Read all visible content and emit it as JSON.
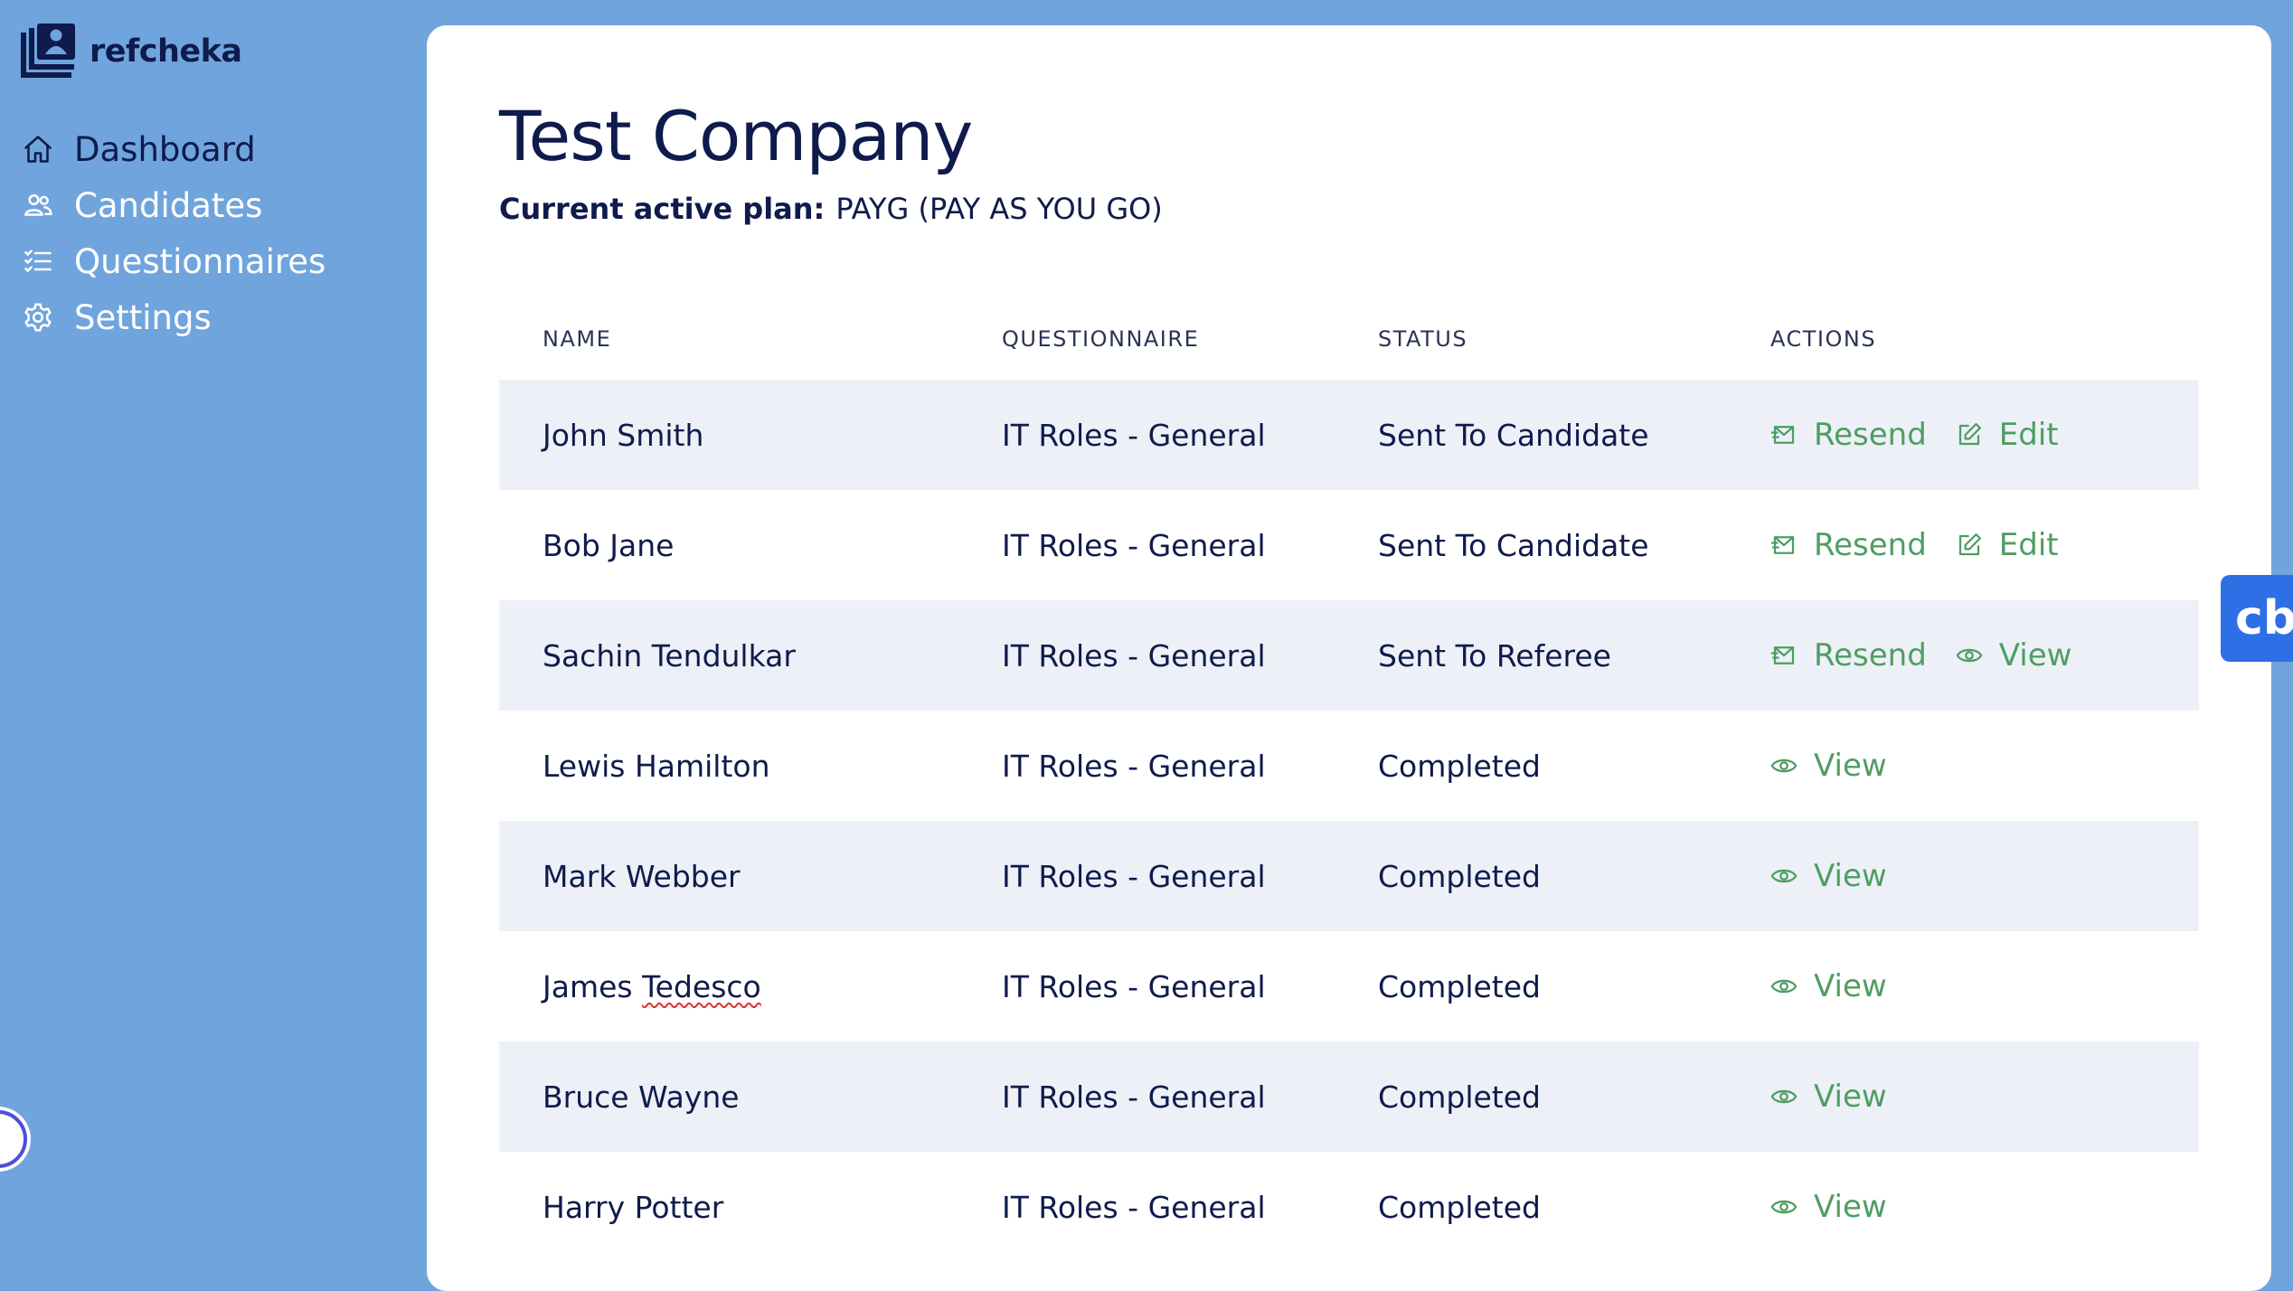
{
  "app": {
    "name": "refcheka"
  },
  "sidebar": {
    "items": [
      {
        "label": "Dashboard",
        "icon": "home-icon",
        "active": true
      },
      {
        "label": "Candidates",
        "icon": "users-icon",
        "active": false
      },
      {
        "label": "Questionnaires",
        "icon": "list-check-icon",
        "active": false
      },
      {
        "label": "Settings",
        "icon": "gear-icon",
        "active": false
      }
    ]
  },
  "main": {
    "title": "Test Company",
    "plan_label": "Current active plan:",
    "plan_value": "PAYG (PAY AS YOU GO)",
    "table": {
      "columns": [
        "NAME",
        "QUESTIONNAIRE",
        "STATUS",
        "ACTIONS"
      ],
      "rows": [
        {
          "name": "John Smith",
          "questionnaire": "IT Roles - General",
          "status": "Sent To Candidate",
          "actions": [
            "Resend",
            "Edit"
          ]
        },
        {
          "name": "Bob Jane",
          "questionnaire": "IT Roles - General",
          "status": "Sent To Candidate",
          "actions": [
            "Resend",
            "Edit"
          ]
        },
        {
          "name": "Sachin Tendulkar",
          "questionnaire": "IT Roles - General",
          "status": "Sent To Referee",
          "actions": [
            "Resend",
            "View"
          ]
        },
        {
          "name": "Lewis Hamilton",
          "questionnaire": "IT Roles - General",
          "status": "Completed",
          "actions": [
            "View"
          ]
        },
        {
          "name": "Mark Webber",
          "questionnaire": "IT Roles - General",
          "status": "Completed",
          "actions": [
            "View"
          ]
        },
        {
          "name": "James",
          "name_flagged": "Tedesco",
          "questionnaire": "IT Roles - General",
          "status": "Completed",
          "actions": [
            "View"
          ]
        },
        {
          "name": "Bruce Wayne",
          "questionnaire": "IT Roles - General",
          "status": "Completed",
          "actions": [
            "View"
          ]
        },
        {
          "name": "Harry Potter",
          "questionnaire": "IT Roles - General",
          "status": "Completed",
          "actions": [
            "View"
          ]
        }
      ]
    }
  },
  "overlay": {
    "badge_text": "cb"
  },
  "colors": {
    "sidebar_bg": "#70a4dd",
    "navy": "#0f1b4c",
    "action_green": "#4f9d62",
    "row_alt": "#edf1f7",
    "badge_blue": "#2f6fe6"
  }
}
